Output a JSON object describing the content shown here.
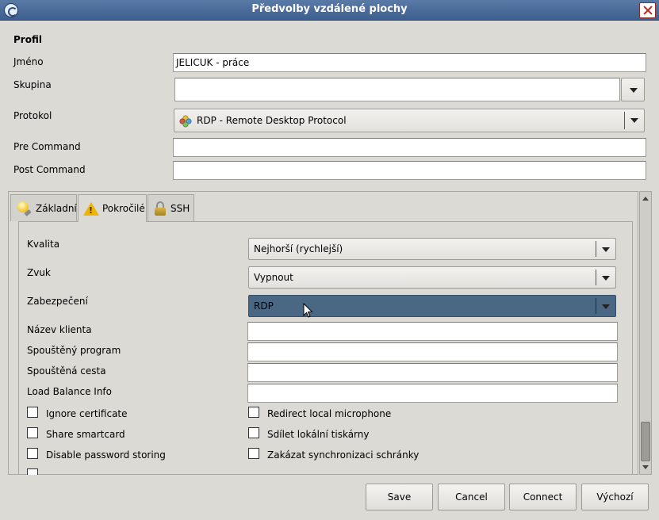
{
  "window": {
    "title": "Předvolby vzdálené plochy"
  },
  "profile": {
    "section_label": "Profil",
    "name_label": "Jméno",
    "name_value": "JELICUK - práce",
    "group_label": "Skupina",
    "group_value": "",
    "protocol_label": "Protokol",
    "protocol_value": "RDP - Remote Desktop Protocol",
    "pre_command_label": "Pre Command",
    "pre_command_value": "",
    "post_command_label": "Post Command",
    "post_command_value": ""
  },
  "tabs": [
    {
      "label": "Základní",
      "icon": "bulb-icon"
    },
    {
      "label": "Pokročilé",
      "icon": "warning-icon"
    },
    {
      "label": "SSH",
      "icon": "lock-icon"
    }
  ],
  "advanced": {
    "quality_label": "Kvalita",
    "quality_value": "Nejhorší (rychlejší)",
    "sound_label": "Zvuk",
    "sound_value": "Vypnout",
    "security_label": "Zabezpečení",
    "security_value": "RDP",
    "client_name_label": "Název klienta",
    "startup_program_label": "Spouštěný program",
    "startup_path_label": "Spouštěná cesta",
    "load_balance_label": "Load Balance Info",
    "checkboxes": {
      "ignore_certificate": "Ignore certificate",
      "share_smartcard": "Share smartcard",
      "disable_password_storing": "Disable password storing",
      "redirect_microphone": "Redirect local microphone",
      "share_printers": "Sdílet lokální tiskárny",
      "disable_clipboard": "Zakázat synchronizaci schránky"
    }
  },
  "buttons": {
    "save": "Save",
    "cancel": "Cancel",
    "connect": "Connect",
    "default": "Výchozí"
  },
  "colors": {
    "titlebar": "#4a6a98",
    "selected_combo": "#4a6784",
    "window_bg": "#dcdad5"
  }
}
